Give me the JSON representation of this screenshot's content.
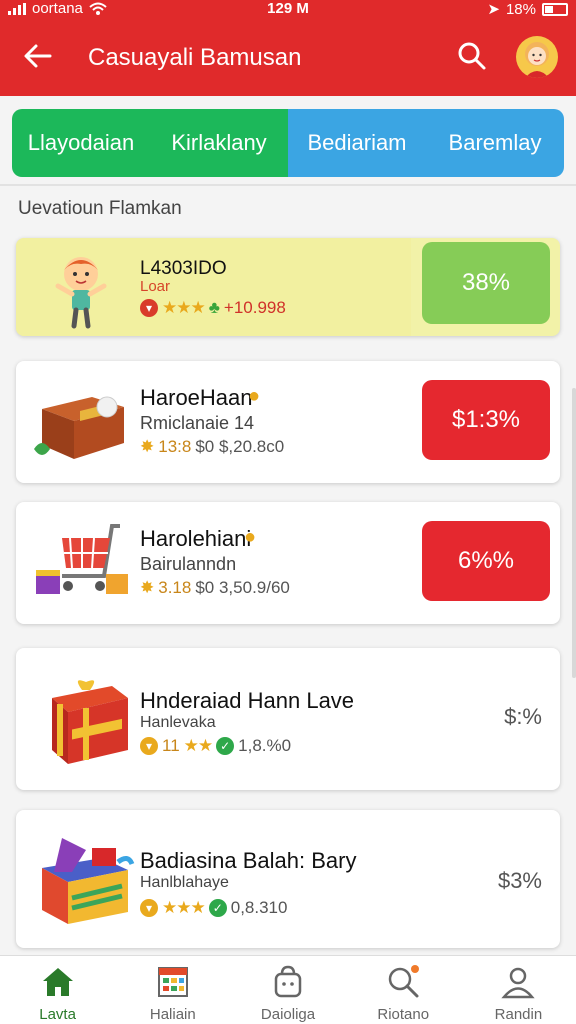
{
  "status": {
    "carrier": "oortana",
    "time": "129 M",
    "battery": "18%"
  },
  "appbar": {
    "title": "Casuayali Bamusan"
  },
  "tabs": [
    {
      "label": "Llayodaian",
      "color": "#1cb85a"
    },
    {
      "label": "Kirlaklany",
      "color": "#1cb85a"
    },
    {
      "label": "Bediariam",
      "color": "#3ba5e3"
    },
    {
      "label": "Baremlay",
      "color": "#3ba5e3"
    }
  ],
  "section": {
    "title": "Uevatioun Flamkan"
  },
  "items": [
    {
      "name": "L4303IDO",
      "sub": "Loar",
      "price": "+10.998",
      "percent": "38%",
      "percent_style": "green",
      "icon": "character-icon"
    },
    {
      "name": "HaroeHaan",
      "sub": "Rmiclanaie  14",
      "rating": "13:8",
      "price": "$0 $,20.8c0",
      "percent": "$1:3%",
      "percent_style": "red",
      "icon": "crate-icon"
    },
    {
      "name": "Harolehiani",
      "sub": "Bairulanndn",
      "rating": "3.18",
      "price": "$0 3,50.9/60",
      "percent": "6%%",
      "percent_style": "red",
      "icon": "cart-icon"
    },
    {
      "name": "Hnderaiad Hann Lave",
      "sub": "Hanlevaka",
      "rating": "11",
      "price": "1,8.%0",
      "percent": "$:%",
      "percent_style": "text",
      "icon": "gift-icon"
    },
    {
      "name": "Badiasina Balah: Bary",
      "sub": "Hanlblahaye",
      "rating": "",
      "price": "0,8.310",
      "percent": "$3%",
      "percent_style": "text",
      "icon": "toybox-icon"
    }
  ],
  "nav": [
    {
      "label": "Lavta",
      "icon": "home-icon"
    },
    {
      "label": "Haliain",
      "icon": "calendar-icon"
    },
    {
      "label": "Daioliga",
      "icon": "bag-icon"
    },
    {
      "label": "Riotano",
      "icon": "search-icon"
    },
    {
      "label": "Randin",
      "icon": "person-icon"
    }
  ],
  "colors": {
    "appbar": "#e02a2b",
    "green": "#1cb85a",
    "blue": "#3ba5e3",
    "red_pill": "#e5282f",
    "green_pill": "#86cc57"
  }
}
